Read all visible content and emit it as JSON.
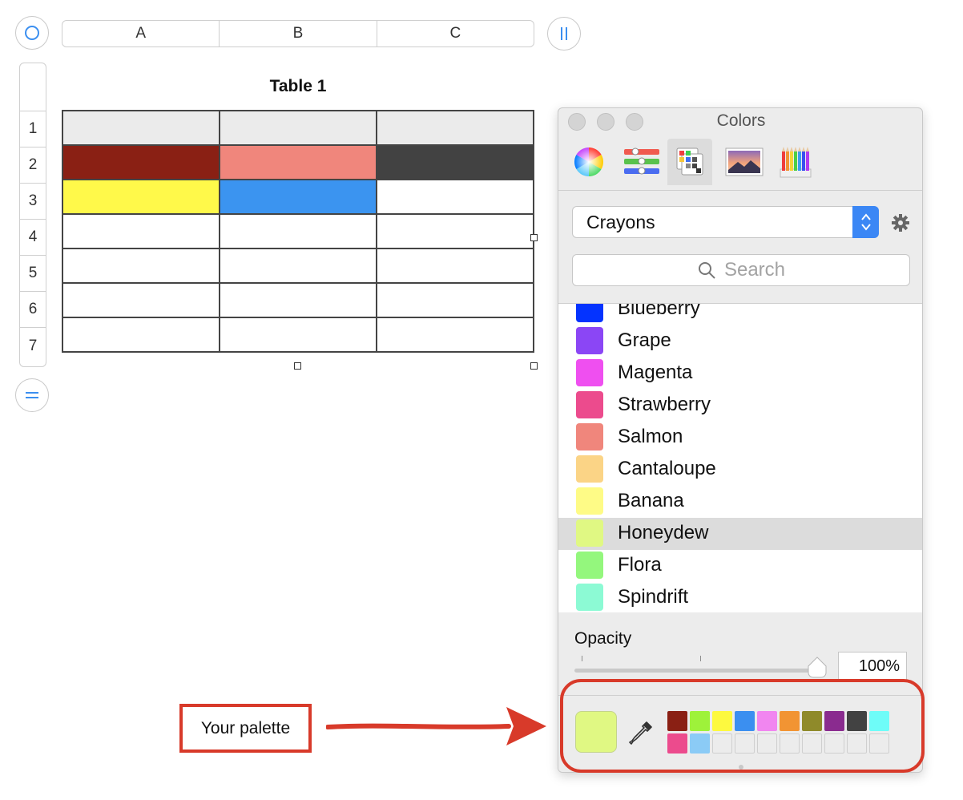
{
  "spreadsheet": {
    "column_headers": [
      "A",
      "B",
      "C"
    ],
    "row_headers": [
      "1",
      "2",
      "3",
      "4",
      "5",
      "6",
      "7"
    ],
    "table_title": "Table 1",
    "cell_fills": [
      [
        "#ebebeb",
        "#ebebeb",
        "#ebebeb"
      ],
      [
        "#8a2014",
        "#f0867c",
        "#424242"
      ],
      [
        "#fff94a",
        "#3b94f0",
        "#ffffff"
      ],
      [
        "#ffffff",
        "#ffffff",
        "#ffffff"
      ],
      [
        "#ffffff",
        "#ffffff",
        "#ffffff"
      ],
      [
        "#ffffff",
        "#ffffff",
        "#ffffff"
      ],
      [
        "#ffffff",
        "#ffffff",
        "#ffffff"
      ]
    ]
  },
  "colors_panel": {
    "title": "Colors",
    "toolbar": [
      "color-wheel-icon",
      "sliders-icon",
      "palettes-icon",
      "image-palettes-icon",
      "pencils-icon"
    ],
    "selected_tool": "palettes-icon",
    "palette_select": "Crayons",
    "search_placeholder": "Search",
    "list": [
      {
        "name": "Blueberry",
        "color": "#0433ff"
      },
      {
        "name": "Grape",
        "color": "#8b46f5"
      },
      {
        "name": "Magenta",
        "color": "#ef4ff0"
      },
      {
        "name": "Strawberry",
        "color": "#ec4b8d"
      },
      {
        "name": "Salmon",
        "color": "#f0867c"
      },
      {
        "name": "Cantaloupe",
        "color": "#fbd486"
      },
      {
        "name": "Banana",
        "color": "#fefb86"
      },
      {
        "name": "Honeydew",
        "color": "#e0f883"
      },
      {
        "name": "Flora",
        "color": "#94f77d"
      },
      {
        "name": "Spindrift",
        "color": "#8cfad4"
      }
    ],
    "selected_item": "Honeydew",
    "opacity_label": "Opacity",
    "opacity_value": "100%",
    "opacity_fraction": 1.0,
    "current_color": "#e0f883",
    "palette_swatches": [
      "#8a2014",
      "#9ef23a",
      "#fdf93f",
      "#3b8ff0",
      "#f186f0",
      "#f29433",
      "#8f8a2a",
      "#8a2b8f",
      "#424242",
      "#6efcf8",
      "#ec4b8d",
      "#8bcbf6",
      "",
      "",
      "",
      "",
      "",
      "",
      "",
      ""
    ]
  },
  "annotation": {
    "label": "Your palette",
    "color": "#d83a2a"
  }
}
